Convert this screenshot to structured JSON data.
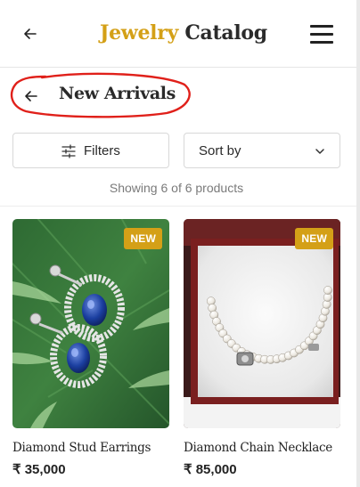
{
  "header": {
    "brand_first": "Jewelry",
    "brand_second": "Catalog",
    "back_icon": "arrow-left-icon",
    "menu_icon": "hamburger-menu-icon"
  },
  "page": {
    "title": "New Arrivals",
    "back_icon": "arrow-left-icon"
  },
  "toolbar": {
    "filters_label": "Filters",
    "filters_icon": "sliders-icon",
    "sort_label": "Sort by",
    "sort_icon": "chevron-down-icon"
  },
  "results": {
    "count_text": "Showing 6 of 6 products"
  },
  "products": [
    {
      "name": "Diamond Stud Earrings",
      "price": "₹ 35,000",
      "badge": "NEW"
    },
    {
      "name": "Diamond Chain Necklace",
      "price": "₹ 85,000",
      "badge": "NEW"
    }
  ],
  "colors": {
    "accent_gold": "#d4a017",
    "annotation_red": "#e0201a"
  }
}
